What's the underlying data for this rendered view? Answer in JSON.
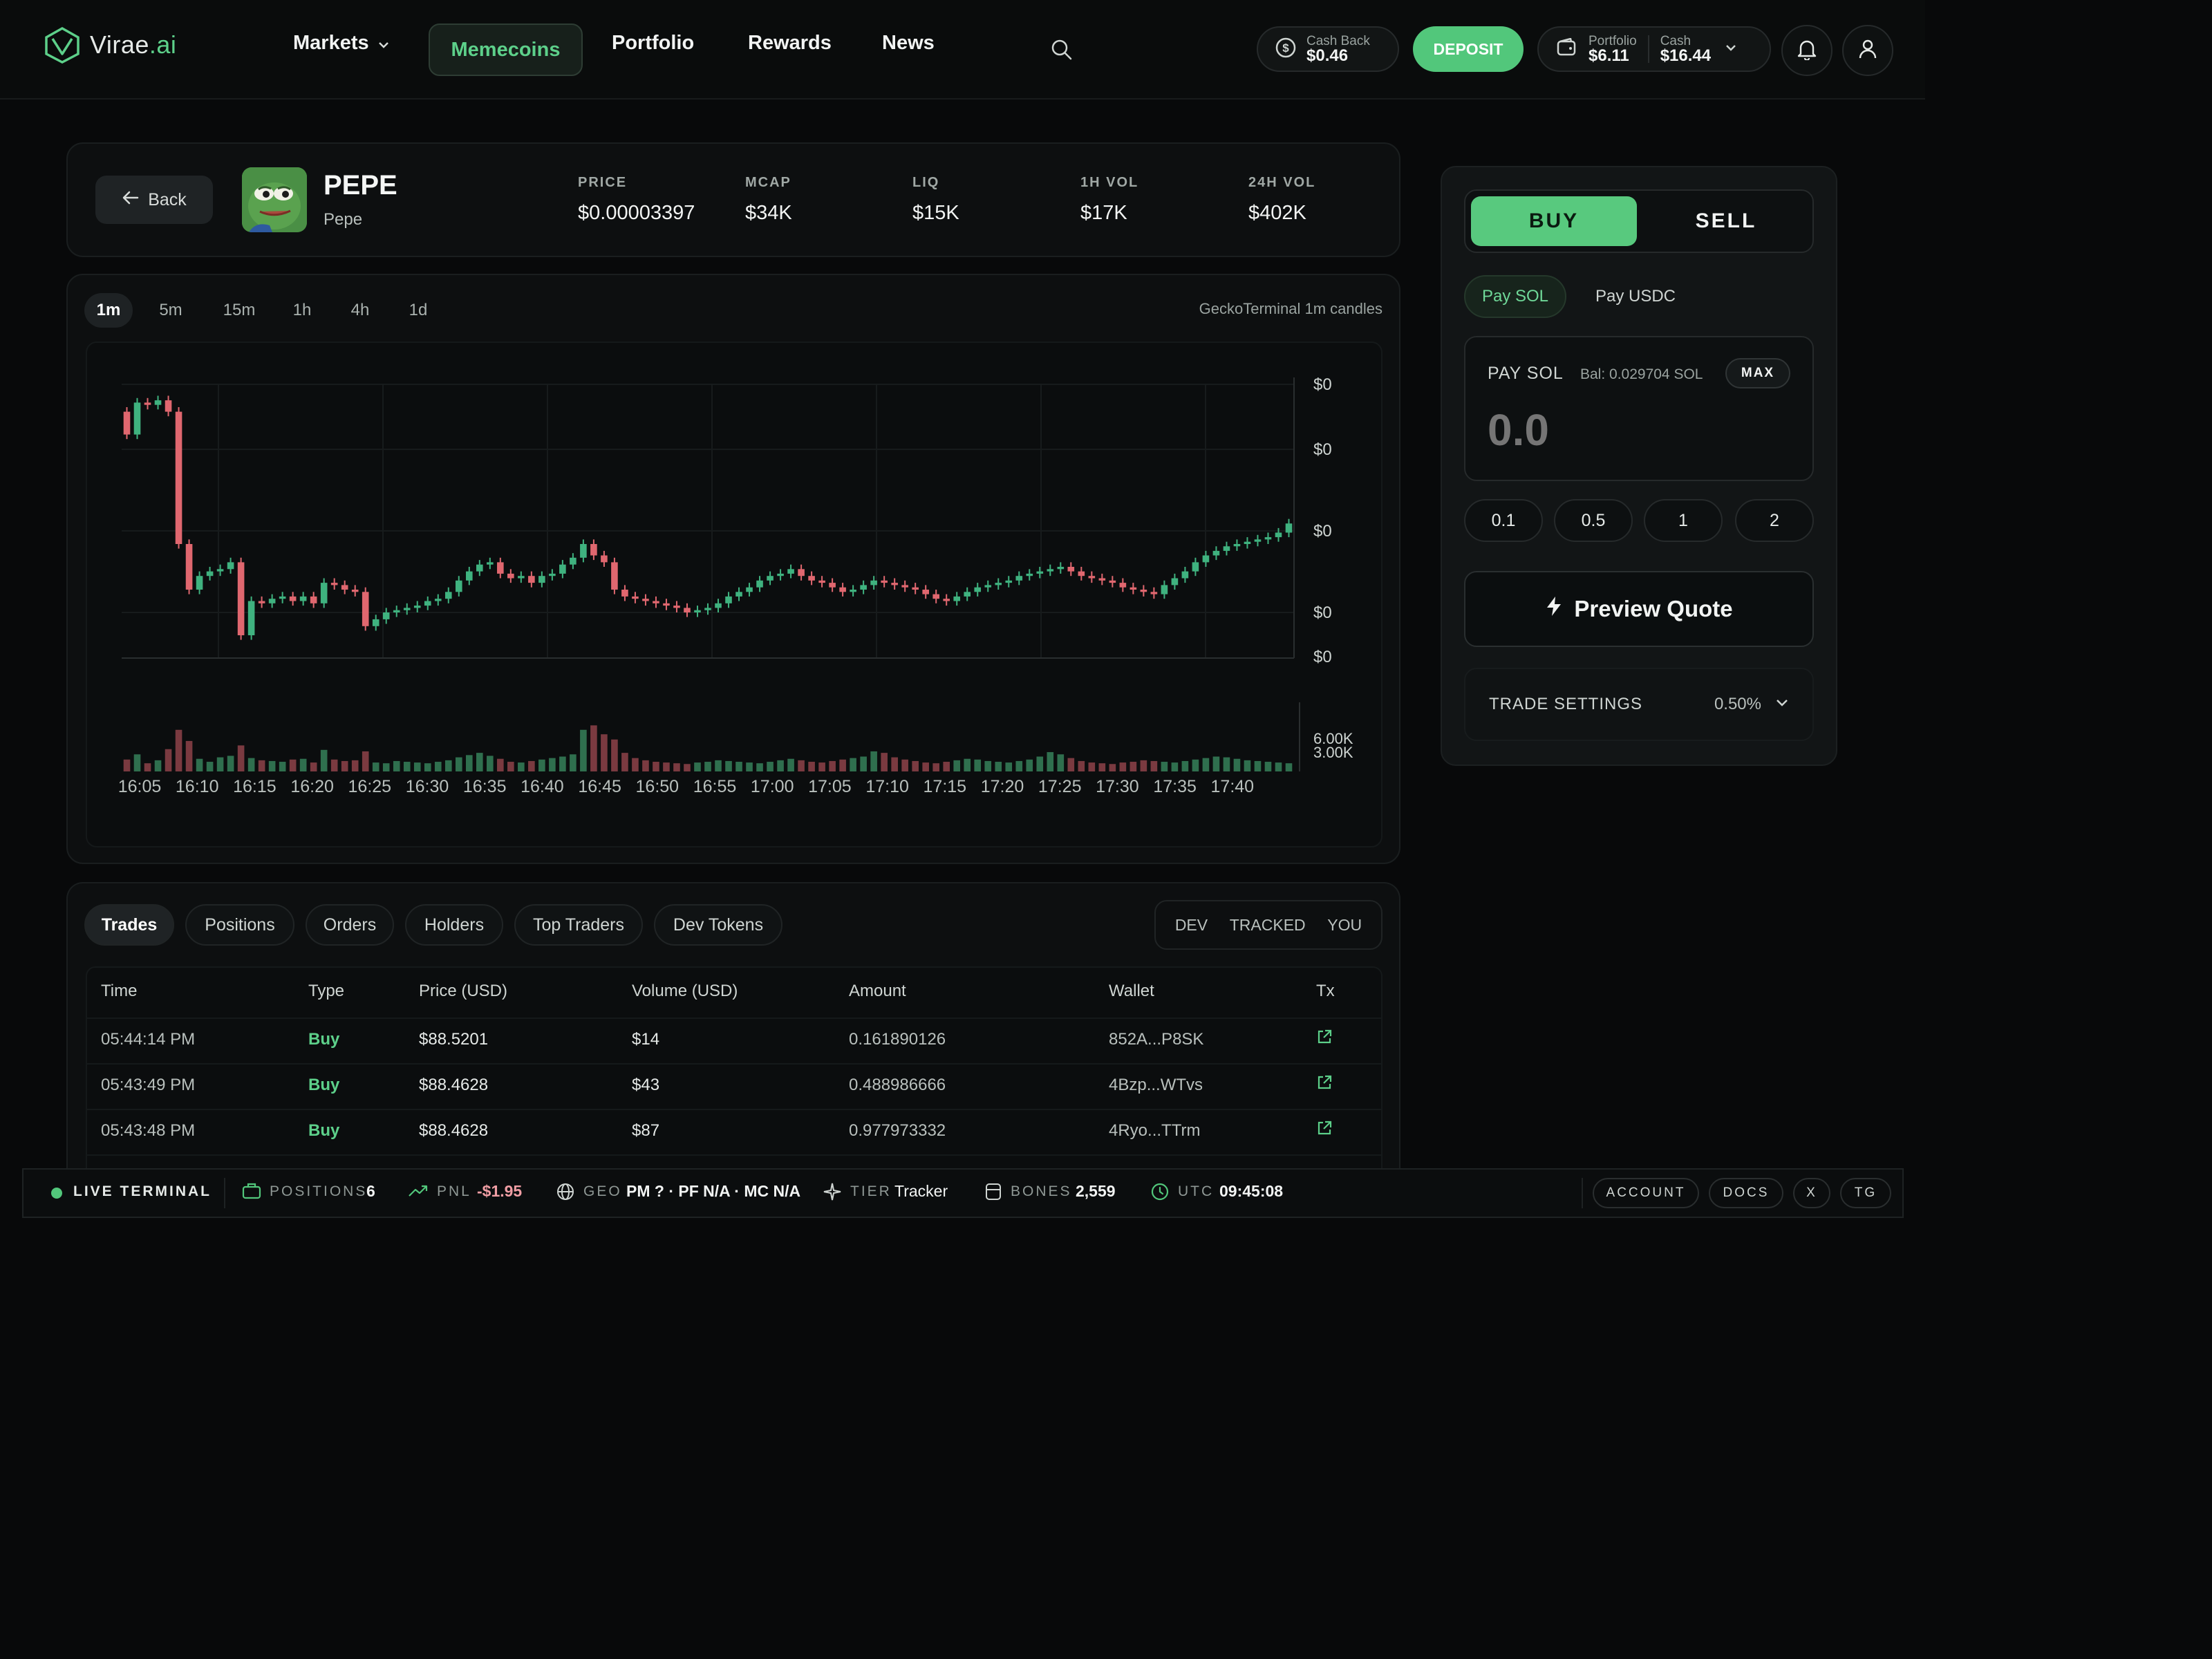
{
  "brand": {
    "name": "Virae",
    "suffix": ".ai",
    "accent": "#5dd08a"
  },
  "nav": {
    "markets": "Markets",
    "memecoins": "Memecoins",
    "portfolio": "Portfolio",
    "rewards": "Rewards",
    "news": "News"
  },
  "header_right": {
    "cash_back_label": "Cash Back",
    "cash_back_value": "$0.46",
    "deposit": "DEPOSIT",
    "portfolio_label": "Portfolio",
    "portfolio_value": "$6.11",
    "cash_label": "Cash",
    "cash_value": "$16.44"
  },
  "token": {
    "back": "Back",
    "symbol": "PEPE",
    "name": "Pepe",
    "stats": [
      {
        "label": "PRICE",
        "value": "$0.00003397"
      },
      {
        "label": "MCAP",
        "value": "$34K"
      },
      {
        "label": "LIQ",
        "value": "$15K"
      },
      {
        "label": "1H VOL",
        "value": "$17K"
      },
      {
        "label": "24H VOL",
        "value": "$402K"
      }
    ]
  },
  "chart": {
    "timeframes": [
      "1m",
      "5m",
      "15m",
      "1h",
      "4h",
      "1d"
    ],
    "active_timeframe": "1m",
    "source_label": "GeckoTerminal 1m candles"
  },
  "chart_data": {
    "type": "candlestick",
    "price_axis_labels": [
      "$0",
      "$0",
      "$0",
      "$0",
      "$0"
    ],
    "volume_axis_labels": [
      "6.00K",
      "3.00K"
    ],
    "time_labels": [
      "16:05",
      "16:10",
      "16:15",
      "16:20",
      "16:25",
      "16:30",
      "16:35",
      "16:40",
      "16:45",
      "16:50",
      "16:55",
      "17:00",
      "17:05",
      "17:10",
      "17:15",
      "17:20",
      "17:25",
      "17:30",
      "17:35",
      "17:40"
    ],
    "up_color": "#3fb27f",
    "down_color": "#e0676f",
    "close": [
      3.78,
      3.92,
      3.91,
      3.93,
      3.88,
      3.3,
      3.1,
      3.16,
      3.18,
      3.19,
      3.22,
      2.9,
      3.05,
      3.04,
      3.06,
      3.07,
      3.05,
      3.07,
      3.04,
      3.13,
      3.12,
      3.1,
      3.09,
      2.94,
      2.97,
      3.0,
      3.01,
      3.02,
      3.03,
      3.05,
      3.06,
      3.09,
      3.14,
      3.18,
      3.21,
      3.22,
      3.17,
      3.15,
      3.16,
      3.13,
      3.16,
      3.17,
      3.21,
      3.24,
      3.3,
      3.25,
      3.22,
      3.1,
      3.07,
      3.06,
      3.05,
      3.04,
      3.03,
      3.02,
      3.0,
      3.01,
      3.02,
      3.04,
      3.07,
      3.09,
      3.11,
      3.14,
      3.16,
      3.17,
      3.19,
      3.16,
      3.14,
      3.13,
      3.11,
      3.09,
      3.1,
      3.12,
      3.14,
      3.13,
      3.12,
      3.11,
      3.1,
      3.08,
      3.06,
      3.05,
      3.07,
      3.09,
      3.11,
      3.12,
      3.13,
      3.14,
      3.16,
      3.17,
      3.18,
      3.19,
      3.2,
      3.18,
      3.16,
      3.15,
      3.14,
      3.13,
      3.11,
      3.1,
      3.09,
      3.08,
      3.12,
      3.15,
      3.18,
      3.22,
      3.25,
      3.27,
      3.29,
      3.3,
      3.31,
      3.32,
      3.33,
      3.35,
      3.39
    ],
    "volume": [
      1.6,
      2.3,
      1.1,
      1.5,
      3.0,
      5.6,
      4.1,
      1.7,
      1.3,
      1.9,
      2.1,
      3.5,
      1.8,
      1.5,
      1.4,
      1.3,
      1.6,
      1.7,
      1.2,
      2.9,
      1.6,
      1.4,
      1.5,
      2.7,
      1.2,
      1.1,
      1.4,
      1.3,
      1.2,
      1.1,
      1.3,
      1.5,
      1.9,
      2.2,
      2.5,
      2.1,
      1.7,
      1.3,
      1.2,
      1.4,
      1.6,
      1.8,
      2.0,
      2.3,
      5.6,
      6.2,
      5.0,
      4.3,
      2.5,
      1.8,
      1.5,
      1.3,
      1.2,
      1.1,
      1.0,
      1.2,
      1.3,
      1.5,
      1.4,
      1.3,
      1.2,
      1.1,
      1.3,
      1.5,
      1.7,
      1.5,
      1.3,
      1.2,
      1.4,
      1.6,
      1.8,
      2.0,
      2.7,
      2.5,
      1.9,
      1.6,
      1.4,
      1.2,
      1.1,
      1.3,
      1.5,
      1.7,
      1.6,
      1.4,
      1.3,
      1.2,
      1.4,
      1.6,
      2.0,
      2.6,
      2.3,
      1.8,
      1.4,
      1.2,
      1.1,
      1.0,
      1.2,
      1.3,
      1.5,
      1.4,
      1.3,
      1.2,
      1.4,
      1.6,
      1.8,
      2.0,
      1.9,
      1.7,
      1.5,
      1.4,
      1.3,
      1.2,
      1.1
    ]
  },
  "trades": {
    "tabs": [
      "Trades",
      "Positions",
      "Orders",
      "Holders",
      "Top Traders",
      "Dev Tokens"
    ],
    "filters": [
      "DEV",
      "TRACKED",
      "YOU"
    ],
    "columns": [
      "Time",
      "Type",
      "Price (USD)",
      "Volume (USD)",
      "Amount",
      "Wallet",
      "Tx"
    ],
    "rows": [
      {
        "time": "05:44:14 PM",
        "type": "Buy",
        "price": "$88.5201",
        "volume": "$14",
        "amount": "0.161890126",
        "wallet": "852A...P8SK"
      },
      {
        "time": "05:43:49 PM",
        "type": "Buy",
        "price": "$88.4628",
        "volume": "$43",
        "amount": "0.488986666",
        "wallet": "4Bzp...WTvs"
      },
      {
        "time": "05:43:48 PM",
        "type": "Buy",
        "price": "$88.4628",
        "volume": "$87",
        "amount": "0.977973332",
        "wallet": "4Ryo...TTrm"
      }
    ]
  },
  "trade_box": {
    "buy": "BUY",
    "sell": "SELL",
    "pay_sol": "Pay SOL",
    "pay_usdc": "Pay USDC",
    "pay_label": "PAY SOL",
    "balance": "Bal: 0.029704 SOL",
    "max": "MAX",
    "amount_placeholder": "0.0",
    "presets": [
      "0.1",
      "0.5",
      "1",
      "2"
    ],
    "preview": "Preview Quote",
    "settings_label": "TRADE SETTINGS",
    "slippage": "0.50%"
  },
  "status_bar": {
    "live": "LIVE TERMINAL",
    "positions_label": "POSITIONS",
    "positions_value": "6",
    "pnl_label": "PNL",
    "pnl_value": "-$1.95",
    "geo_label": "GEO",
    "geo_value": "PM ? · PF N/A · MC N/A",
    "tier_label": "TIER",
    "tier_value": "Tracker",
    "bones_label": "BONES",
    "bones_value": "2,559",
    "utc_label": "UTC",
    "utc_value": "09:45:08",
    "account": "ACCOUNT",
    "docs": "DOCS",
    "x": "X",
    "tg": "TG"
  }
}
